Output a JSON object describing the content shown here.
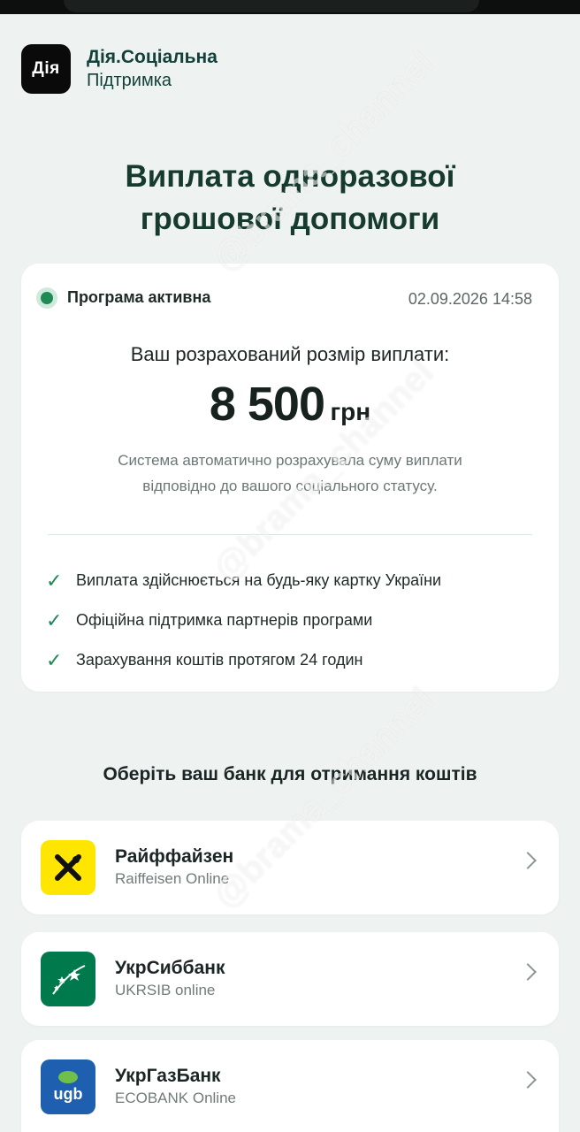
{
  "app": {
    "logo_text": "Дія",
    "name": "Дія.Соціальна",
    "subtitle": "Підтримка"
  },
  "page": {
    "title_line1": "Виплата одноразової",
    "title_line2": "грошової допомоги"
  },
  "program": {
    "status": "Програма активна",
    "timestamp": "02.09.2026 14:58",
    "amount_label": "Ваш розрахований розмір виплати:",
    "amount_value": "8 500",
    "amount_currency": "грн",
    "description_line1": "Система автоматично розрахувала суму виплати",
    "description_line2": "відповідно до вашого соціального статусу.",
    "benefits": [
      {
        "text": "Виплата здійснюється на будь-яку картку України"
      },
      {
        "text": "Офіційна підтримка партнерів програми"
      },
      {
        "text": "Зарахування коштів протягом 24 годин"
      }
    ],
    "check_icon": "✓"
  },
  "banks": {
    "heading": "Оберіть ваш банк для отримання коштів",
    "items": [
      {
        "name": "Райффайзен",
        "subtitle": "Raiffeisen Online",
        "logo_color": "#ffe600"
      },
      {
        "name": "УкрСиббанк",
        "subtitle": "UKRSIB online",
        "logo_color": "#007a4d"
      },
      {
        "name": "УкрГазБанк",
        "subtitle": "ECOBANK Online",
        "logo_color": "#1f5fb0",
        "logo_text": "ugb"
      }
    ]
  },
  "watermark": {
    "text": "@brama_channel"
  },
  "colors": {
    "background": "#eef3f1",
    "accent_green": "#1f8a55",
    "title_green": "#173a2f"
  }
}
